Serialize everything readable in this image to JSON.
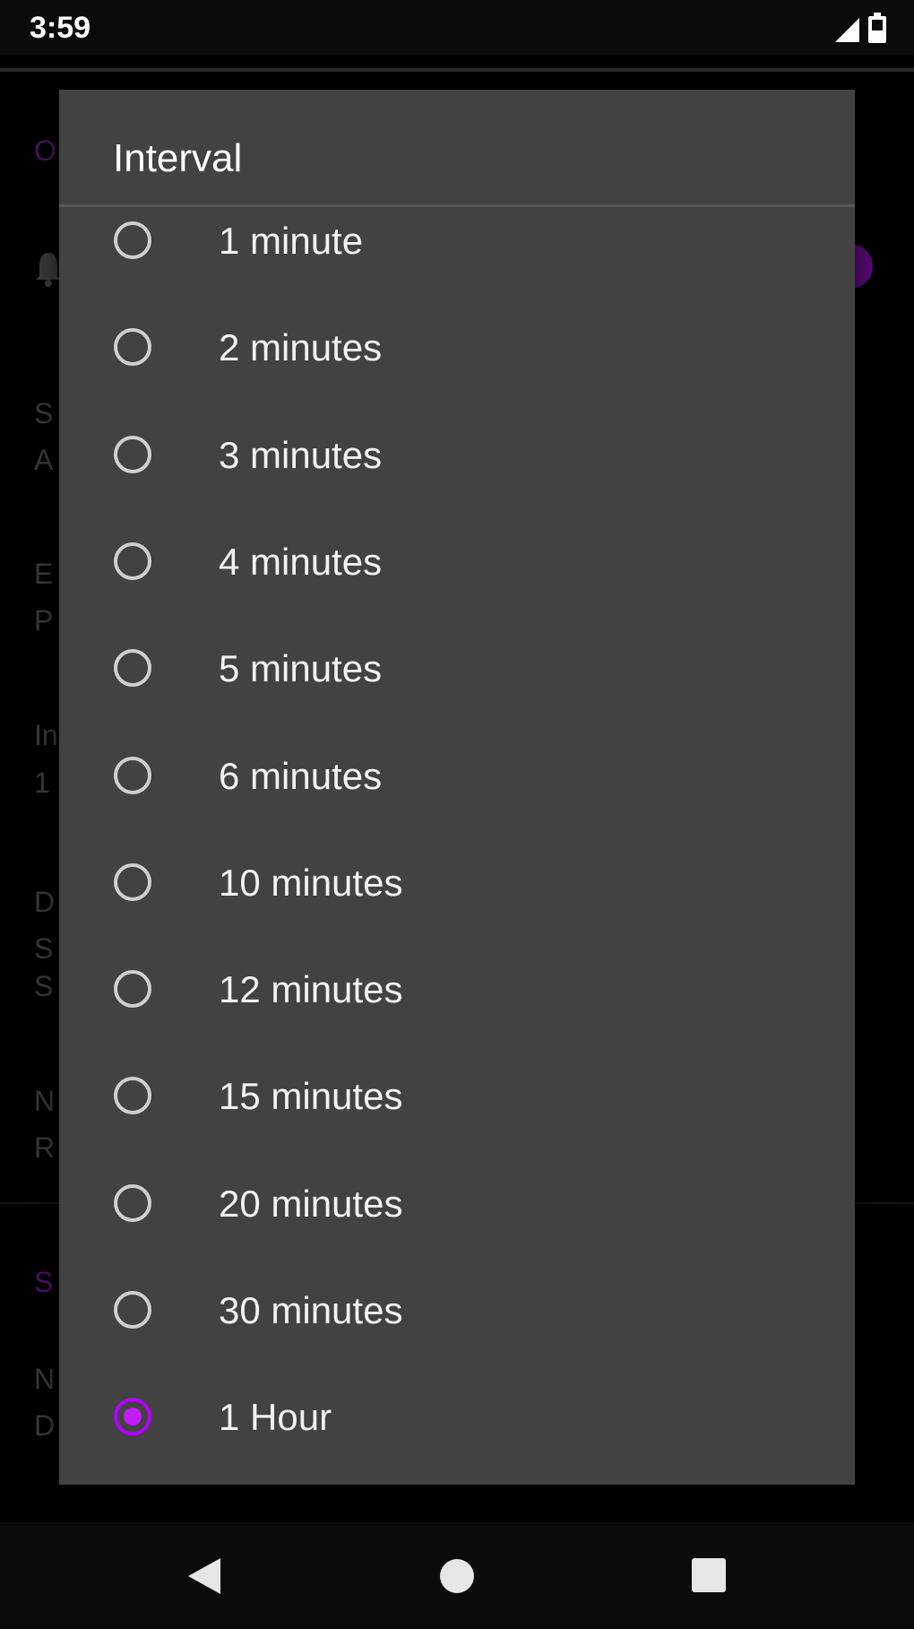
{
  "status_bar": {
    "time": "3:59",
    "icons": [
      "signal-icon",
      "battery-icon"
    ]
  },
  "background": {
    "partial_text": [
      "O",
      "S",
      "A",
      "E",
      "P",
      "In",
      "1",
      "D",
      "S",
      "S",
      "N",
      "R",
      "S",
      "N",
      "D"
    ],
    "accent_color": "#4a1366"
  },
  "dialog": {
    "title": "Interval",
    "options": [
      {
        "label": "1 minute",
        "checked": false
      },
      {
        "label": "2 minutes",
        "checked": false
      },
      {
        "label": "3 minutes",
        "checked": false
      },
      {
        "label": "4 minutes",
        "checked": false
      },
      {
        "label": "5 minutes",
        "checked": false
      },
      {
        "label": "6 minutes",
        "checked": false
      },
      {
        "label": "10 minutes",
        "checked": false
      },
      {
        "label": "12 minutes",
        "checked": false
      },
      {
        "label": "15 minutes",
        "checked": false
      },
      {
        "label": "20 minutes",
        "checked": false
      },
      {
        "label": "30 minutes",
        "checked": false
      },
      {
        "label": "1 Hour",
        "checked": true
      }
    ],
    "selected": "1 Hour",
    "accent_color": "#c21cff"
  },
  "nav_bar": {
    "buttons": [
      "back-icon",
      "home-icon",
      "recents-icon"
    ]
  }
}
